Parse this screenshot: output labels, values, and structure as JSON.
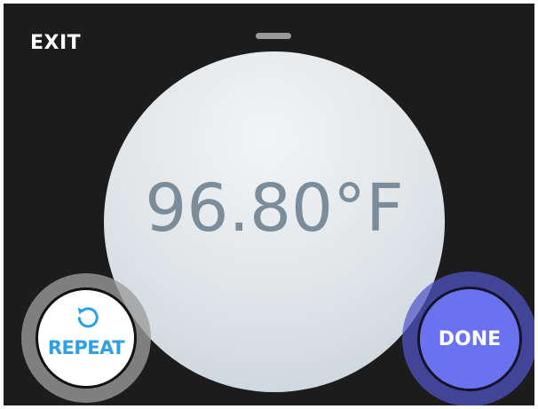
{
  "header": {
    "exit_label": "EXIT",
    "handle_icon": "drag-handle-icon"
  },
  "reading": {
    "temperature": "96.80°F"
  },
  "actions": {
    "repeat_label": "REPEAT",
    "repeat_icon": "refresh-icon",
    "done_label": "DONE"
  },
  "colors": {
    "background": "#1c1c1c",
    "repeat_text": "#2f9fe6",
    "done_button": "#6a72f0",
    "temperature_text": "#7b8d9a"
  }
}
